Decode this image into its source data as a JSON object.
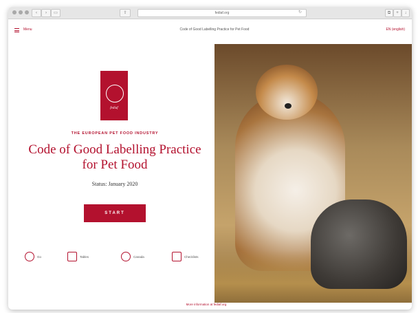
{
  "browser": {
    "url": "fediaf.org"
  },
  "header": {
    "menu_label": "Menu",
    "page_heading": "Code of Good Labelling Practice for Pet Food",
    "language": "EN (english)"
  },
  "hero": {
    "logo_text": "fediaf",
    "kicker": "THE EUROPEAN PET FOOD INDUSTRY",
    "title": "Code of Good Labelling Practice for Pet Food",
    "status": "Status: January 2020",
    "start_label": "START"
  },
  "features": [
    {
      "label": "Go",
      "icon": "clock-icon"
    },
    {
      "label": "Tables",
      "icon": "table-icon"
    },
    {
      "label": "Canada",
      "icon": "cloud-icon"
    },
    {
      "label": "Checklists",
      "icon": "checklist-icon"
    }
  ],
  "footer": {
    "link": "More information at fediaf.org"
  },
  "colors": {
    "accent": "#b3112e"
  }
}
